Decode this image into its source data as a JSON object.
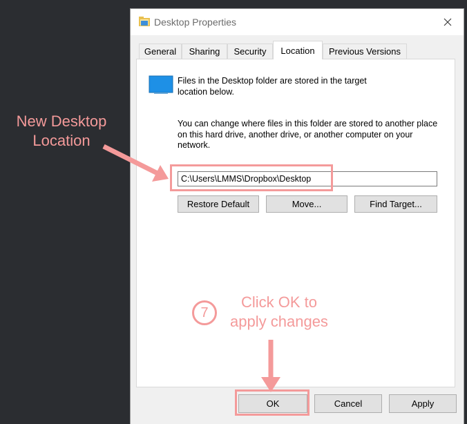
{
  "window": {
    "title": "Desktop Properties"
  },
  "tabs": [
    {
      "label": "General"
    },
    {
      "label": "Sharing"
    },
    {
      "label": "Security"
    },
    {
      "label": "Location"
    },
    {
      "label": "Previous Versions"
    }
  ],
  "location_tab": {
    "description_1": "Files in the Desktop folder are stored in the target location below.",
    "description_2": "You can change where files in this folder are stored to another place on this hard drive, another drive, or another computer on your network.",
    "path_value": "C:\\Users\\LMMS\\Dropbox\\Desktop",
    "restore_default_label": "Restore Default",
    "move_label": "Move...",
    "find_target_label": "Find Target..."
  },
  "footer": {
    "ok_label": "OK",
    "cancel_label": "Cancel",
    "apply_label": "Apply"
  },
  "annotations": {
    "new_location_label": "New Desktop Location",
    "step_number": "7",
    "click_ok_label": "Click OK to apply changes",
    "highlight_color": "#f49a9a"
  },
  "icons": {
    "title_icon": "folder-icon",
    "close": "close-icon",
    "location_icon": "desktop-folder-icon"
  }
}
